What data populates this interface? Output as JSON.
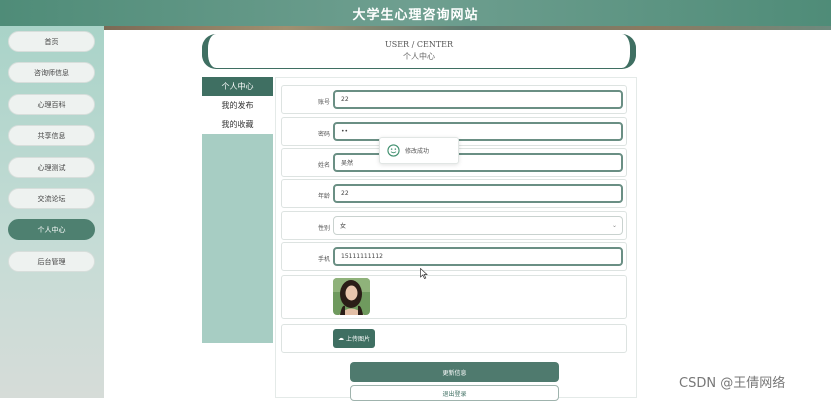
{
  "header": {
    "title": "大学生心理咨询网站"
  },
  "sidebar": {
    "items": [
      {
        "label": "首页"
      },
      {
        "label": "咨询师信息"
      },
      {
        "label": "心理百科"
      },
      {
        "label": "共享信息"
      },
      {
        "label": "心理测试"
      },
      {
        "label": "交流论坛"
      },
      {
        "label": "个人中心",
        "active": true
      },
      {
        "label": "后台管理"
      }
    ]
  },
  "banner": {
    "en": "USER / CENTER",
    "cn": "个人中心"
  },
  "submenu": {
    "items": [
      {
        "label": "个人中心",
        "active": true
      },
      {
        "label": "我的发布"
      },
      {
        "label": "我的收藏"
      }
    ]
  },
  "form": {
    "account": {
      "label": "账号",
      "value": "22"
    },
    "password": {
      "label": "密码",
      "value": "••"
    },
    "name": {
      "label": "姓名",
      "value": "吴然"
    },
    "age": {
      "label": "年龄",
      "value": "22"
    },
    "gender": {
      "label": "性别",
      "value": "女"
    },
    "phone": {
      "label": "手机",
      "value": "15111111112"
    },
    "upload_label": "上传图片",
    "update_label": "更新信息",
    "logout_label": "退出登录"
  },
  "toast": {
    "text": "修改成功"
  },
  "watermark": "CSDN @王倩网络",
  "colors": {
    "primary": "#3f6f62",
    "sidebar_bg": "#a9d3c8",
    "header_bg": "#4f8c78"
  }
}
